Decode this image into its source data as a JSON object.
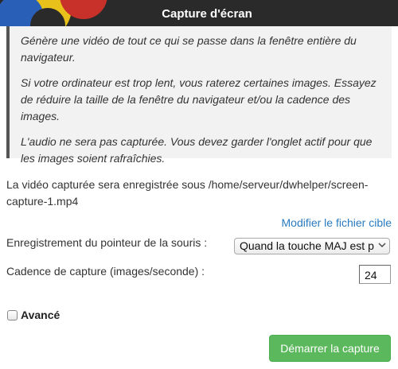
{
  "header": {
    "title": "Capture d'écran"
  },
  "info": {
    "paragraphs": [
      "Génère une vidéo de tout ce qui se passe dans la fenêtre entière du navigateur.",
      "Si votre ordinateur est trop lent, vous raterez certaines images. Essayez de réduire la taille de la fenêtre du navigateur et/ou la cadence des images.",
      "L'audio ne sera pas capturée. Vous devez garder l'onglet actif pour que les images soient rafraîchies."
    ]
  },
  "output": {
    "path_text": "La vidéo capturée sera enregistrée sous /home/serveur/dwhelper/screen-capture-1.mp4",
    "modify_link": "Modifier le fichier cible"
  },
  "settings": {
    "pointer_label": "Enregistrement du pointeur de la souris :",
    "pointer_value": "Quand la touche MAJ est p",
    "framerate_label": "Cadence de capture (images/seconde) :",
    "framerate_value": "24"
  },
  "advanced": {
    "label": "Avancé",
    "checked": false
  },
  "actions": {
    "start_label": "Démarrer la capture"
  },
  "colors": {
    "header_bg": "#2a2a2a",
    "accent_green": "#5cb85c",
    "link_blue": "#2a7bbf"
  },
  "icons": {
    "logo": "logo-icon",
    "select_chevron": "chevron-down-icon"
  }
}
